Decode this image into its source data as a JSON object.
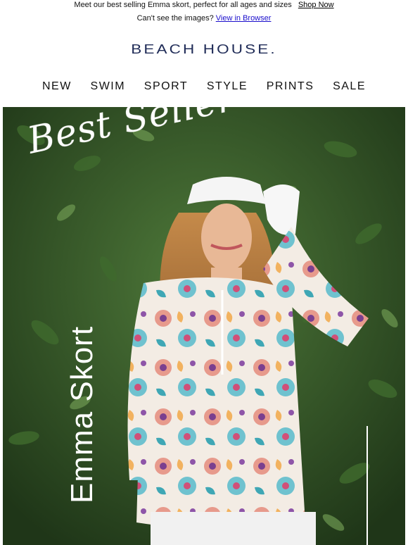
{
  "preheader": {
    "text": "Meet our best selling Emma skort, perfect for all ages and sizes",
    "link": "Shop Now"
  },
  "view_browser": {
    "text": "Can't see the images?",
    "link": "View in Browser"
  },
  "brand": {
    "logo": "BEACH HOUSE."
  },
  "nav": {
    "items": [
      "NEW",
      "SWIM",
      "SPORT",
      "STYLE",
      "PRINTS",
      "SALE"
    ]
  },
  "hero": {
    "script_title": "Best Seller",
    "vertical_title": "Emma Skort"
  },
  "colors": {
    "logo": "#1f2b57",
    "link": "#1a0dcc",
    "foliage": "#2d4a22"
  }
}
